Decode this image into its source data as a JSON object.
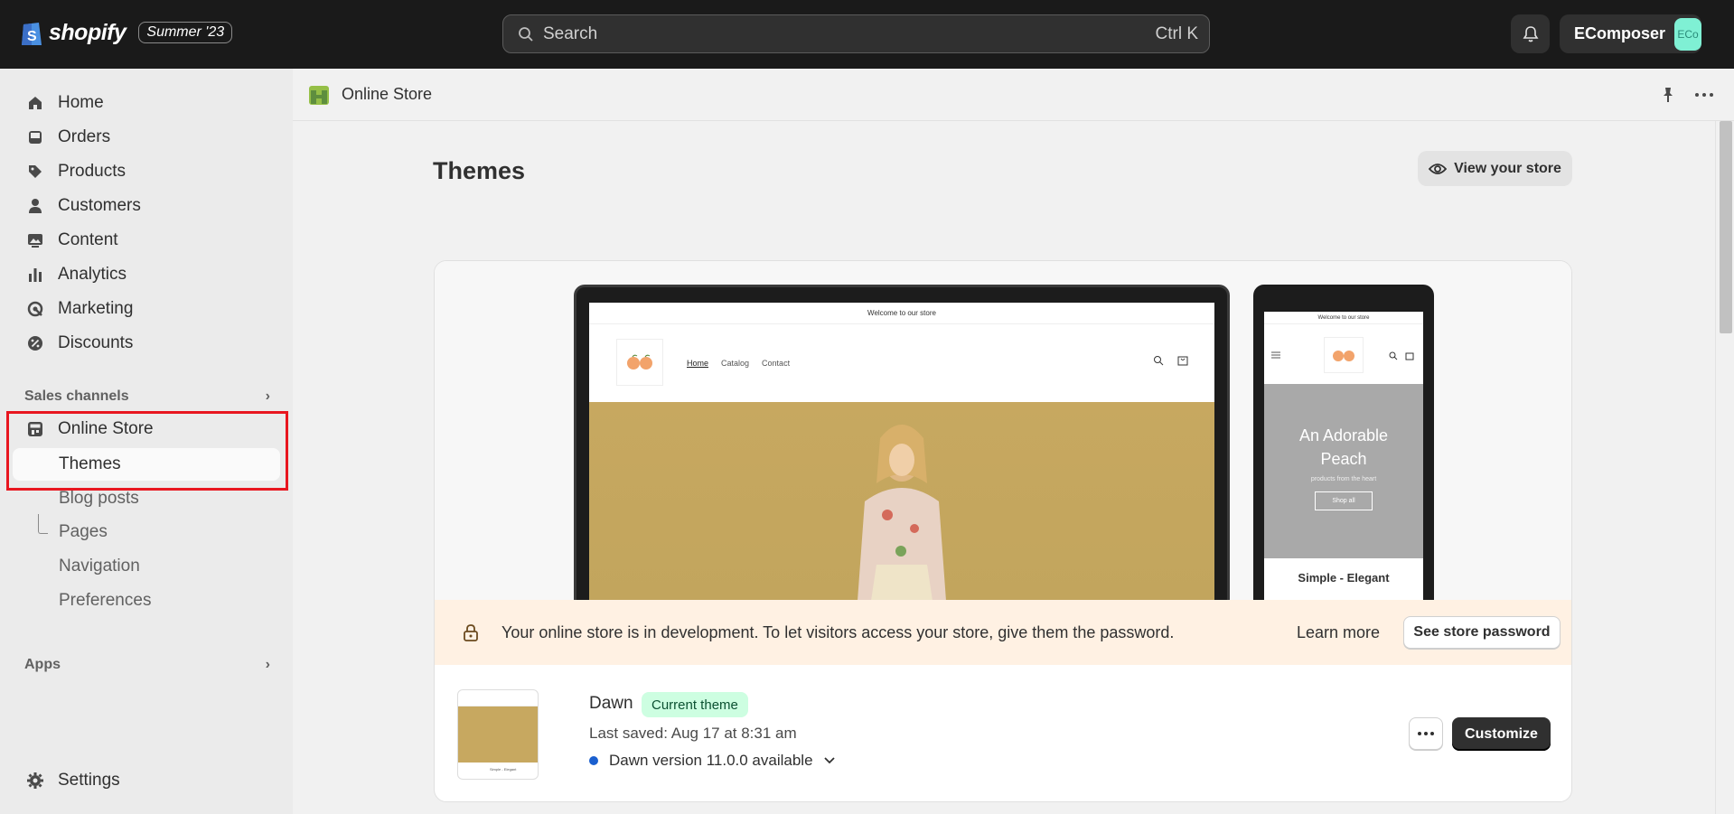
{
  "topbar": {
    "brand": "shopify",
    "edition_badge": "Summer '23",
    "search_placeholder": "Search",
    "search_shortcut": "Ctrl K",
    "account_name": "EComposer",
    "avatar_initials": "ECo"
  },
  "sidebar": {
    "items": [
      {
        "label": "Home",
        "icon": "home-icon"
      },
      {
        "label": "Orders",
        "icon": "inbox-icon"
      },
      {
        "label": "Products",
        "icon": "tag-icon"
      },
      {
        "label": "Customers",
        "icon": "person-icon"
      },
      {
        "label": "Content",
        "icon": "image-icon"
      },
      {
        "label": "Analytics",
        "icon": "bar-chart-icon"
      },
      {
        "label": "Marketing",
        "icon": "target-icon"
      },
      {
        "label": "Discounts",
        "icon": "discount-icon"
      }
    ],
    "sales_channels_header": "Sales channels",
    "online_store_label": "Online Store",
    "sub_items": [
      "Themes",
      "Blog posts",
      "Pages",
      "Navigation",
      "Preferences"
    ],
    "apps_header": "Apps",
    "settings_label": "Settings"
  },
  "main": {
    "breadcrumb": "Online Store",
    "page_title": "Themes",
    "view_store_label": "View your store",
    "preview": {
      "announcement": "Welcome to our store",
      "nav": [
        "Home",
        "Catalog",
        "Contact"
      ],
      "mobile_hero_title": "An Adorable Peach",
      "mobile_hero_subtitle": "products from the heart",
      "mobile_hero_button": "Shop all",
      "mobile_caption": "Simple - Elegant"
    },
    "banner": {
      "text": "Your online store is in development. To let visitors access your store, give them the password.",
      "learn_more": "Learn more",
      "password_button": "See store password"
    },
    "theme": {
      "name": "Dawn",
      "badge": "Current theme",
      "last_saved": "Last saved: Aug 17 at 8:31 am",
      "version_notice": "Dawn version 11.0.0 available",
      "customize_label": "Customize"
    }
  }
}
